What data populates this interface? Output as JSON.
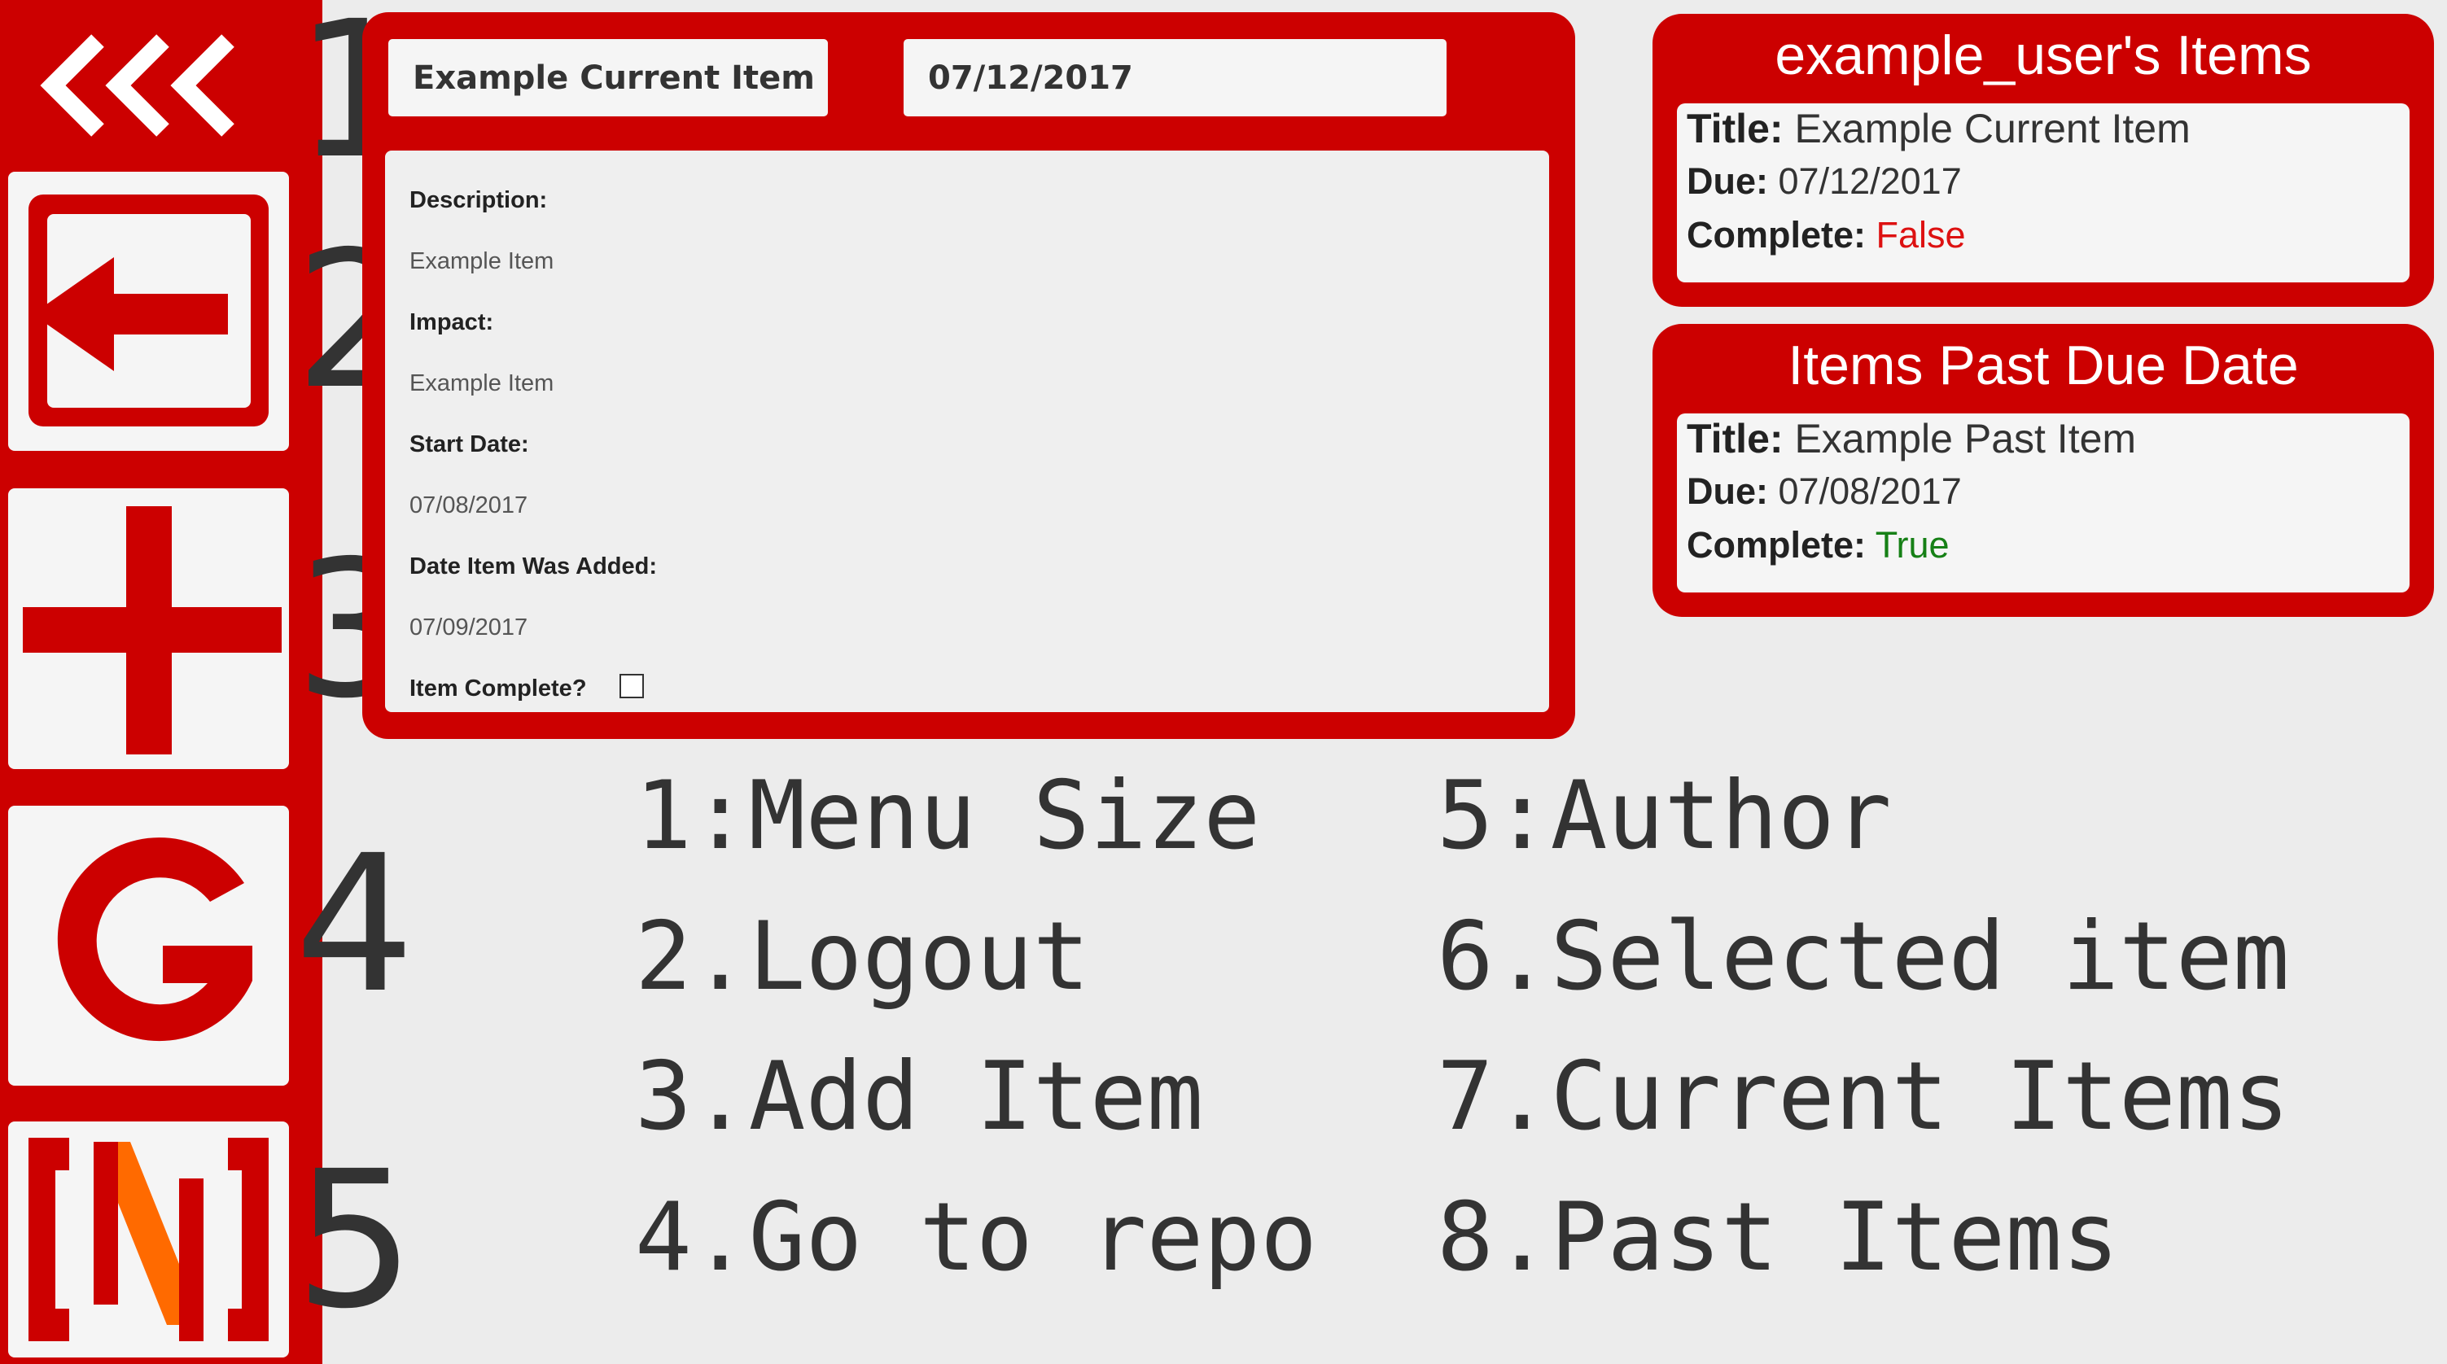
{
  "sidebar": {
    "collapse_icon": "triple-chevron-left-icon",
    "buttons": [
      {
        "name": "logout-button",
        "icon": "arrow-left-box-icon"
      },
      {
        "name": "add-item-button",
        "icon": "plus-icon"
      },
      {
        "name": "repo-button",
        "icon": "g-logo-icon"
      },
      {
        "name": "author-button",
        "icon": "n-logo-icon"
      }
    ]
  },
  "callouts": [
    "1",
    "2",
    "3",
    "4",
    "5",
    "6",
    "7",
    "8"
  ],
  "selected_item": {
    "title": "Example Current Item",
    "date": "07/12/2017",
    "description_label": "Description:",
    "description": "Example Item",
    "impact_label": "Impact:",
    "impact": "Example Item",
    "start_date_label": "Start Date:",
    "start_date": "07/08/2017",
    "date_added_label": "Date Item Was Added:",
    "date_added": "07/09/2017",
    "complete_label": "Item Complete?",
    "complete": false
  },
  "current_items": {
    "heading": "example_user's Items",
    "title_label": "Title:",
    "title": "Example Current Item",
    "due_label": "Due:",
    "due": "07/12/2017",
    "complete_label": "Complete:",
    "complete": "False"
  },
  "past_items": {
    "heading": "Items Past Due Date",
    "title_label": "Title:",
    "title": "Example Past Item",
    "due_label": "Due:",
    "due": "07/08/2017",
    "complete_label": "Complete:",
    "complete": "True"
  },
  "legend": {
    "col1": [
      "1:Menu Size",
      "2.Logout",
      "3.Add Item",
      "4.Go to repo"
    ],
    "col2": [
      "5:Author",
      "6.Selected item",
      "7.Current Items",
      "8.Past Items"
    ]
  },
  "colors": {
    "accent": "#cc0000",
    "false": "#dd1111",
    "true": "#168016",
    "n_logo_stroke": "#ff6a00"
  }
}
